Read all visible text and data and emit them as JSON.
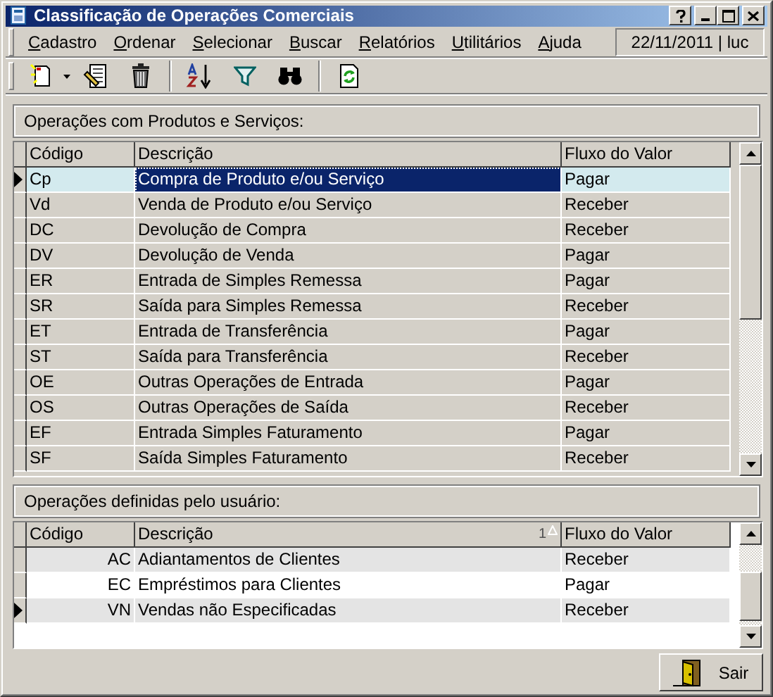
{
  "window": {
    "title": "Classificação de Operações Comerciais"
  },
  "menu": [
    {
      "label": "Cadastro"
    },
    {
      "label": "Ordenar"
    },
    {
      "label": "Selecionar"
    },
    {
      "label": "Buscar"
    },
    {
      "label": "Relatórios"
    },
    {
      "label": "Utilitários"
    },
    {
      "label": "Ajuda"
    }
  ],
  "session": "22/11/2011 | luc",
  "products_panel": {
    "title": "Operações com Produtos e Serviços:",
    "columns": [
      {
        "label": "Código"
      },
      {
        "label": "Descrição"
      },
      {
        "label": "Fluxo do Valor"
      }
    ],
    "rows": [
      {
        "code": "Cp",
        "description": "Compra de Produto e/ou Serviço",
        "flow": "Pagar",
        "selected": true
      },
      {
        "code": "Vd",
        "description": "Venda de Produto e/ou Serviço",
        "flow": "Receber",
        "selected": false
      },
      {
        "code": "DC",
        "description": "Devolução de Compra",
        "flow": "Receber",
        "selected": false
      },
      {
        "code": "DV",
        "description": "Devolução de Venda",
        "flow": "Pagar",
        "selected": false
      },
      {
        "code": "ER",
        "description": "Entrada de Simples Remessa",
        "flow": "Pagar",
        "selected": false
      },
      {
        "code": "SR",
        "description": "Saída para Simples Remessa",
        "flow": "Receber",
        "selected": false
      },
      {
        "code": "ET",
        "description": "Entrada de Transferência",
        "flow": "Pagar",
        "selected": false
      },
      {
        "code": "ST",
        "description": "Saída para Transferência",
        "flow": "Receber",
        "selected": false
      },
      {
        "code": "OE",
        "description": "Outras Operações de Entrada",
        "flow": "Pagar",
        "selected": false
      },
      {
        "code": "OS",
        "description": "Outras Operações de Saída",
        "flow": "Receber",
        "selected": false
      },
      {
        "code": "EF",
        "description": "Entrada Simples Faturamento",
        "flow": "Pagar",
        "selected": false
      },
      {
        "code": "SF",
        "description": "Saída Simples Faturamento",
        "flow": "Receber",
        "selected": false
      }
    ]
  },
  "user_panel": {
    "title": "Operações definidas pelo usuário:",
    "columns": [
      {
        "label": "Código"
      },
      {
        "label": "Descrição",
        "sort_index": "1"
      },
      {
        "label": "Fluxo do Valor"
      }
    ],
    "rows": [
      {
        "code": "AC",
        "description": "Adiantamentos de Clientes",
        "flow": "Receber",
        "selected": false
      },
      {
        "code": "EC",
        "description": "Empréstimos para Clientes",
        "flow": "Pagar",
        "selected": false
      },
      {
        "code": "VN",
        "description": "Vendas não Especificadas",
        "flow": "Receber",
        "selected": true
      }
    ]
  },
  "buttons": [
    {
      "label": "Sair"
    }
  ]
}
